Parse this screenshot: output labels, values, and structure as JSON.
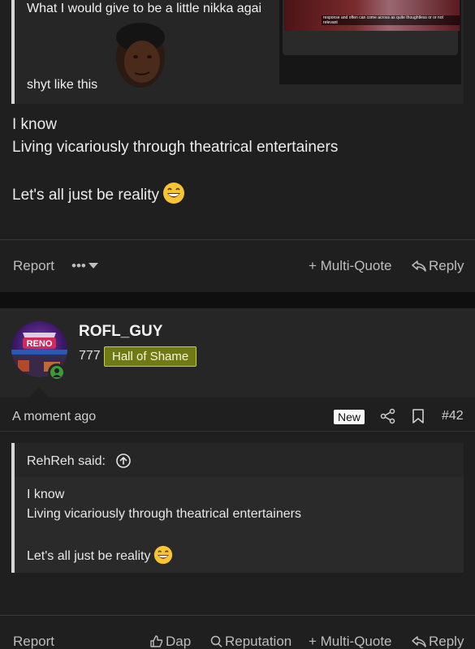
{
  "post1": {
    "quote_line1": "What I would give to be a little nikka agai",
    "quote_line2": "shyt like this",
    "embed_caption": "response and often can come across as quite thoughtless or or not relevant",
    "body": [
      "I know",
      "Living vicariously through theatrical entertainers",
      "Let's all just be reality"
    ],
    "emoji": "grinning-face",
    "actions": {
      "report": "Report",
      "more": "•••",
      "multi_quote": "+ Multi-Quote",
      "reply": "Reply"
    }
  },
  "post2": {
    "username": "ROFL_GUY",
    "points": "777",
    "badge": "Hall of Shame",
    "avatar_text": "RENO",
    "time": "A moment ago",
    "new_badge": "New",
    "post_number": "#42",
    "quote": {
      "author_said": "RehReh said:",
      "body": [
        "I know",
        "Living vicariously through theatrical entertainers",
        "Let's all just be reality"
      ]
    },
    "actions": {
      "report": "Report",
      "dap": "Dap",
      "reputation": "Reputation",
      "multi_quote": "+ Multi-Quote",
      "reply": "Reply"
    }
  },
  "colors": {
    "background": "#1f1f1f",
    "quote_border": "#d6d6d6",
    "badge_bg": "#707a14",
    "online": "#3c9a3a"
  }
}
